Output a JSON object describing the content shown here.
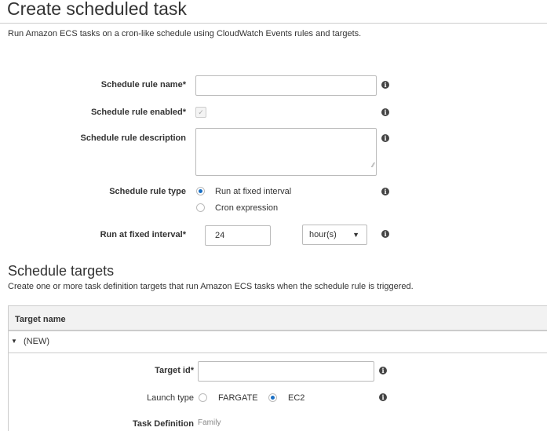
{
  "page": {
    "title": "Create scheduled task",
    "subtitle": "Run Amazon ECS tasks on a cron-like schedule using CloudWatch Events rules and targets."
  },
  "form": {
    "rule_name_label": "Schedule rule name*",
    "rule_name_value": "",
    "enabled_label": "Schedule rule enabled*",
    "enabled_checked": true,
    "description_label": "Schedule rule description",
    "description_value": "",
    "type_label": "Schedule rule type",
    "type_options": [
      "Run at fixed interval",
      "Cron expression"
    ],
    "type_selected": "Run at fixed interval",
    "interval_label": "Run at fixed interval*",
    "interval_value": "24",
    "interval_unit": "hour(s)"
  },
  "targets": {
    "title": "Schedule targets",
    "subtitle": "Create one or more task definition targets that run Amazon ECS tasks when the schedule rule is triggered.",
    "column_header": "Target name",
    "row_label": "(NEW)",
    "target_id_label": "Target id*",
    "target_id_value": "",
    "launch_type_label": "Launch type",
    "launch_options": [
      "FARGATE",
      "EC2"
    ],
    "launch_selected": "EC2",
    "task_def_label": "Task Definition",
    "family_label": "Family"
  },
  "info_icon": "i"
}
